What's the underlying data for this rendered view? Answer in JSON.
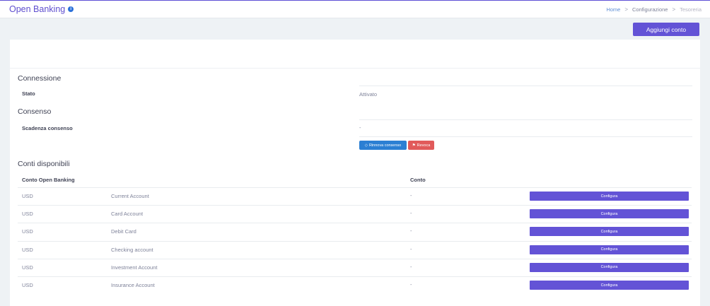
{
  "header": {
    "title": "Open Banking",
    "breadcrumb": [
      "Home",
      "Configurazione",
      "Tesoreria"
    ],
    "separator": ">"
  },
  "actions": {
    "add_account_label": "Aggiungi conto"
  },
  "connection": {
    "title": "Connessione",
    "status_label": "Stato",
    "status_value": "Attivato"
  },
  "consent": {
    "title": "Consenso",
    "expiry_label": "Scadenza consenso",
    "expiry_value": "-",
    "renew_label": "Rinnova consenso",
    "revoke_label": "Revoca"
  },
  "accounts": {
    "title": "Conti disponibili",
    "columns": [
      "Conto Open Banking",
      "Conto"
    ],
    "configure_label": "Configura",
    "rows": [
      {
        "currency": "USD",
        "name": "Current Account",
        "conto": "-"
      },
      {
        "currency": "USD",
        "name": "Card Account",
        "conto": "-"
      },
      {
        "currency": "USD",
        "name": "Debit Card",
        "conto": "-"
      },
      {
        "currency": "USD",
        "name": "Checking account",
        "conto": "-"
      },
      {
        "currency": "USD",
        "name": "Investment Account",
        "conto": "-"
      },
      {
        "currency": "USD",
        "name": "Insurance Account",
        "conto": "-"
      }
    ]
  },
  "colors": {
    "primary": "#6353d6",
    "info": "#2b7fd3",
    "danger": "#e15a5a",
    "background": "#eef2f5"
  },
  "icons": {
    "title_info": "info-icon",
    "renew": "tag-icon",
    "revoke": "bookmark-icon"
  }
}
